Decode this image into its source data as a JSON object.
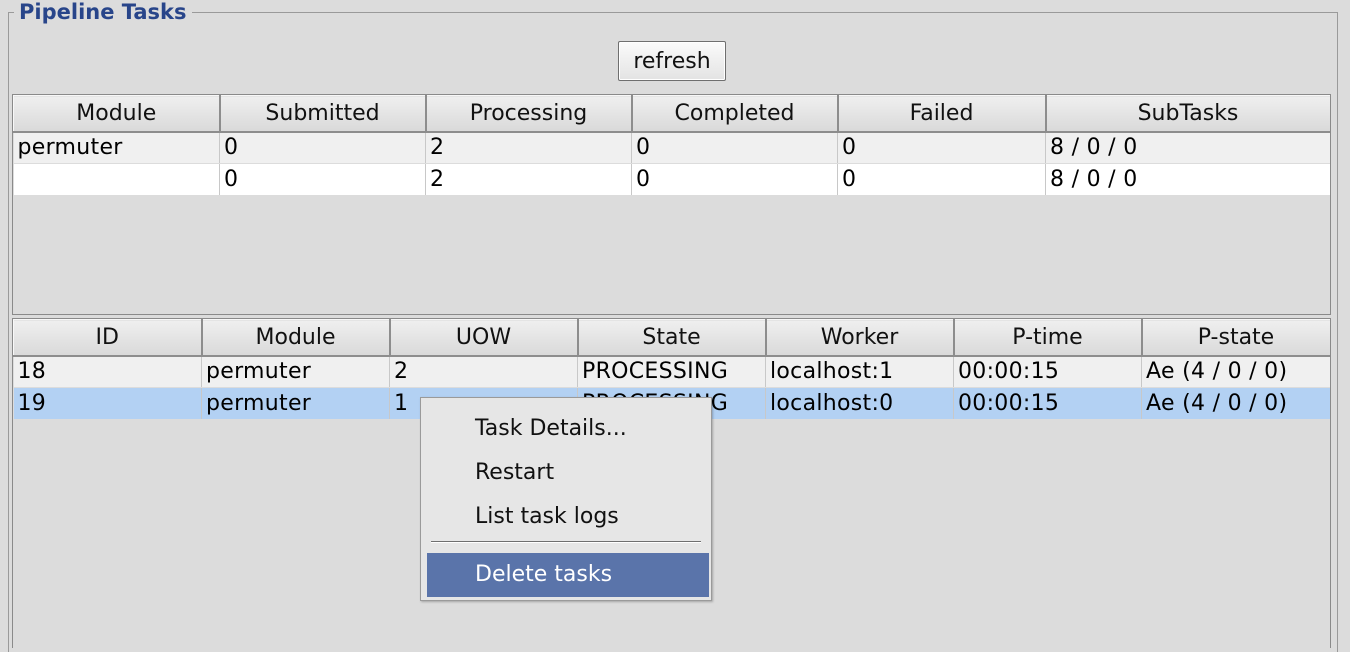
{
  "group": {
    "title": "Pipeline Tasks"
  },
  "toolbar": {
    "refresh_label": "refresh"
  },
  "summary_table": {
    "headers": [
      "Module",
      "Submitted",
      "Processing",
      "Completed",
      "Failed",
      "SubTasks"
    ],
    "rows": [
      [
        "permuter",
        "0",
        "2",
        "0",
        "0",
        "8 / 0 / 0"
      ],
      [
        "",
        "0",
        "2",
        "0",
        "0",
        "8 / 0 / 0"
      ]
    ]
  },
  "tasks_table": {
    "headers": [
      "ID",
      "Module",
      "UOW",
      "State",
      "Worker",
      "P-time",
      "P-state"
    ],
    "rows": [
      [
        "18",
        "permuter",
        "2",
        "PROCESSING",
        "localhost:1",
        "00:00:15",
        "Ae (4 / 0 / 0)"
      ],
      [
        "19",
        "permuter",
        "1",
        "PROCESSING",
        "localhost:0",
        "00:00:15",
        "Ae (4 / 0 / 0)"
      ]
    ],
    "selected_row": 1
  },
  "context_menu": {
    "items": [
      "Task Details...",
      "Restart",
      "List task logs",
      "Delete tasks"
    ],
    "highlighted": "Delete tasks"
  },
  "colors": {
    "title": "#28458a",
    "selection": "#b3d1f3",
    "menu_highlight": "#5a74aa"
  }
}
